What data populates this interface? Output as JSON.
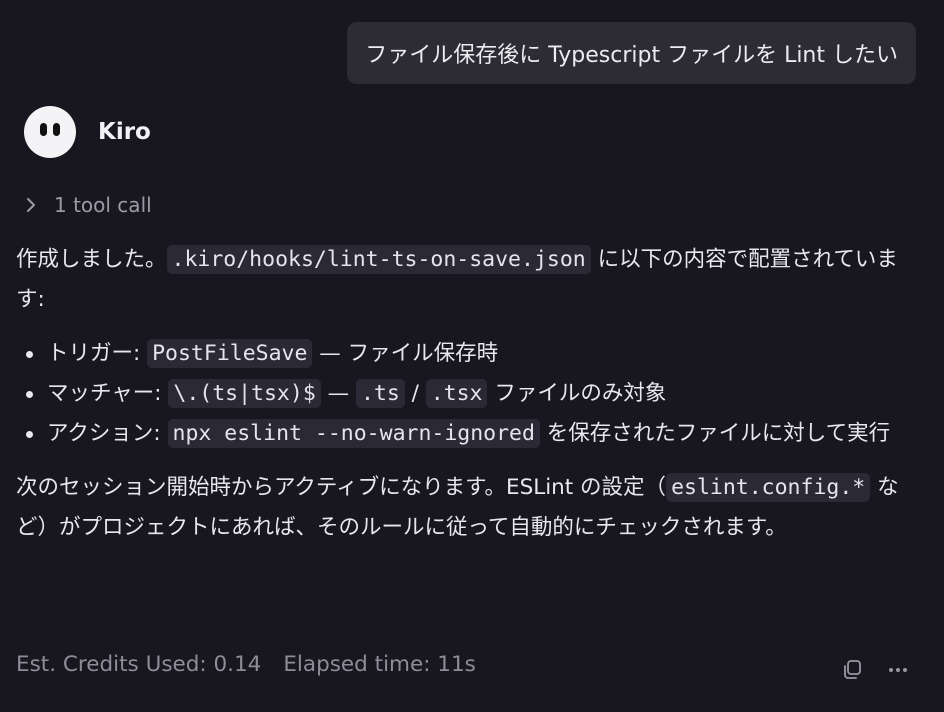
{
  "user_message": "ファイル保存後に Typescript ファイルを Lint したい",
  "agent": {
    "name": "Kiro",
    "avatar_icon": "ghost-face-icon"
  },
  "tool_call": {
    "label": "1 tool call",
    "icon": "chevron-right-icon"
  },
  "response": {
    "intro_text": "作成しました。",
    "intro_code": ".kiro/hooks/lint-ts-on-save.json",
    "intro_suffix": " に以下の内容で配置されています:",
    "bullets": [
      {
        "label": "トリガー: ",
        "code": "PostFileSave",
        "text": " — ファイル保存時"
      },
      {
        "label": "マッチャー: ",
        "code": "\\.(ts|tsx)$",
        "text": " — ",
        "code2": ".ts",
        "text2": " / ",
        "code3": ".tsx",
        "text3": " ファイルのみ対象"
      },
      {
        "label": "アクション: ",
        "code": "npx eslint --no-warn-ignored",
        "text": " を保存されたファイルに対して実行"
      }
    ],
    "outro_text": "次のセッション開始時からアクティブになります。ESLint の設定（",
    "outro_code": "eslint.config.*",
    "outro_suffix": " など）がプロジェクトにあれば、そのルールに従って自動的にチェックされます。"
  },
  "footer": {
    "credits": "Est. Credits Used: 0.14",
    "elapsed": "Elapsed time: 11s",
    "copy_icon": "copy-icon",
    "more_icon": "more-horizontal-icon"
  },
  "colors": {
    "background": "#18161e",
    "user_bubble": "#2e2c33",
    "code_bg": "#2c2937",
    "muted_text": "#8f8c98"
  }
}
